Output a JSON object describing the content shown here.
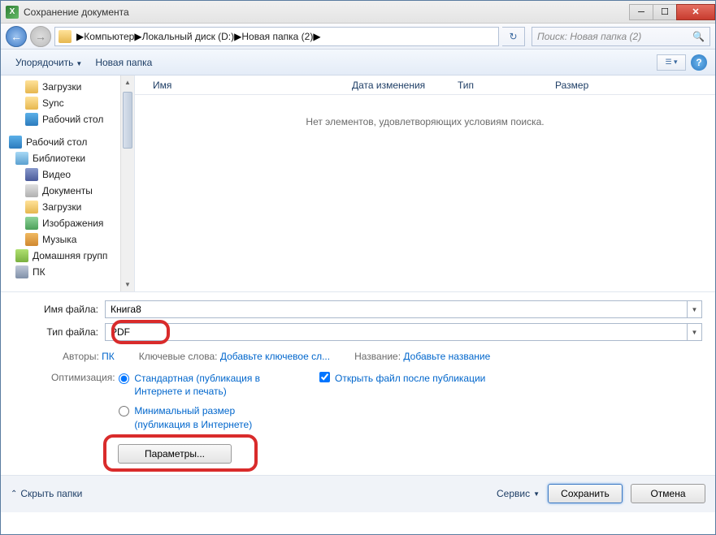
{
  "window": {
    "title": "Сохранение документа"
  },
  "breadcrumbs": {
    "root": "Компьютер",
    "disk": "Локальный диск (D:)",
    "folder": "Новая папка (2)"
  },
  "search": {
    "placeholder": "Поиск: Новая папка (2)"
  },
  "toolbar": {
    "organize": "Упорядочить",
    "new_folder": "Новая папка"
  },
  "columns": {
    "name": "Имя",
    "date": "Дата изменения",
    "type": "Тип",
    "size": "Размер"
  },
  "tree": {
    "downloads": "Загрузки",
    "sync": "Sync",
    "desktop_fav": "Рабочий стол",
    "desktop": "Рабочий стол",
    "libraries": "Библиотеки",
    "video": "Видео",
    "documents": "Документы",
    "downloads2": "Загрузки",
    "images": "Изображения",
    "music": "Музыка",
    "homegroup": "Домашняя групп",
    "pc": "ПК"
  },
  "empty_msg": "Нет элементов, удовлетворяющих условиям поиска.",
  "form": {
    "filename_label": "Имя файла:",
    "filename_value": "Книга8",
    "filetype_label": "Тип файла:",
    "filetype_value": "PDF"
  },
  "meta": {
    "authors_label": "Авторы:",
    "authors_value": "ПК",
    "keywords_label": "Ключевые слова:",
    "keywords_link": "Добавьте ключевое сл...",
    "title_label": "Название:",
    "title_link": "Добавьте название"
  },
  "optimization": {
    "label": "Оптимизация:",
    "standard": "Стандартная (публикация в Интернете и печать)",
    "minimal": "Минимальный размер (публикация в Интернете)",
    "open_after": "Открыть файл после публикации",
    "options_btn": "Параметры..."
  },
  "footer": {
    "hide_folders": "Скрыть папки",
    "tools": "Сервис",
    "save": "Сохранить",
    "cancel": "Отмена"
  }
}
